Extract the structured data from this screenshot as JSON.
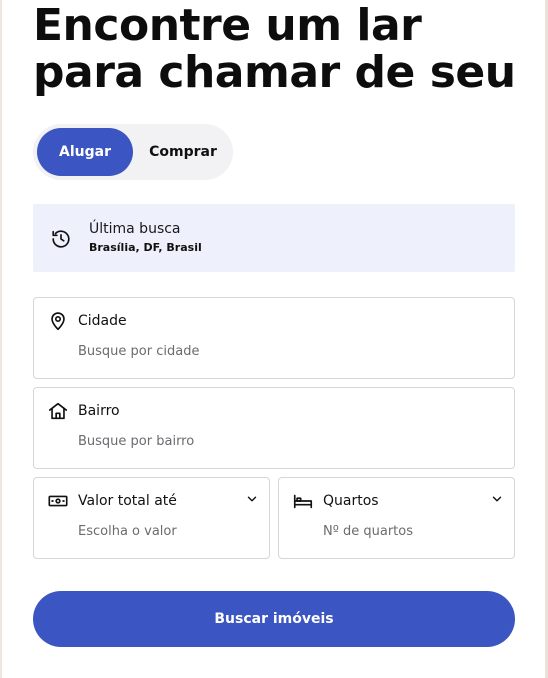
{
  "hero": {
    "title": "Encontre um lar para chamar de seu"
  },
  "mode_toggle": {
    "rent_label": "Alugar",
    "buy_label": "Comprar",
    "selected": "Alugar"
  },
  "recent_search": {
    "label": "Última busca",
    "value": "Brasília, DF, Brasil"
  },
  "fields": {
    "city": {
      "label": "Cidade",
      "placeholder": "Busque por cidade"
    },
    "neighborhood": {
      "label": "Bairro",
      "placeholder": "Busque por bairro"
    },
    "price": {
      "label": "Valor total até",
      "placeholder": "Escolha o valor"
    },
    "bedrooms": {
      "label": "Quartos",
      "placeholder": "Nº de quartos"
    }
  },
  "search_button": {
    "label": "Buscar imóveis"
  },
  "colors": {
    "accent": "#3b55c2",
    "recent_bg": "#eef0fc",
    "toggle_bg": "#f2f2f4",
    "border": "#d6d6d9"
  },
  "icons": {
    "recent": "history-icon",
    "city": "map-pin-icon",
    "neighborhood": "house-icon",
    "price": "banknote-icon",
    "bedrooms": "bed-icon",
    "dropdown": "chevron-down-icon"
  }
}
